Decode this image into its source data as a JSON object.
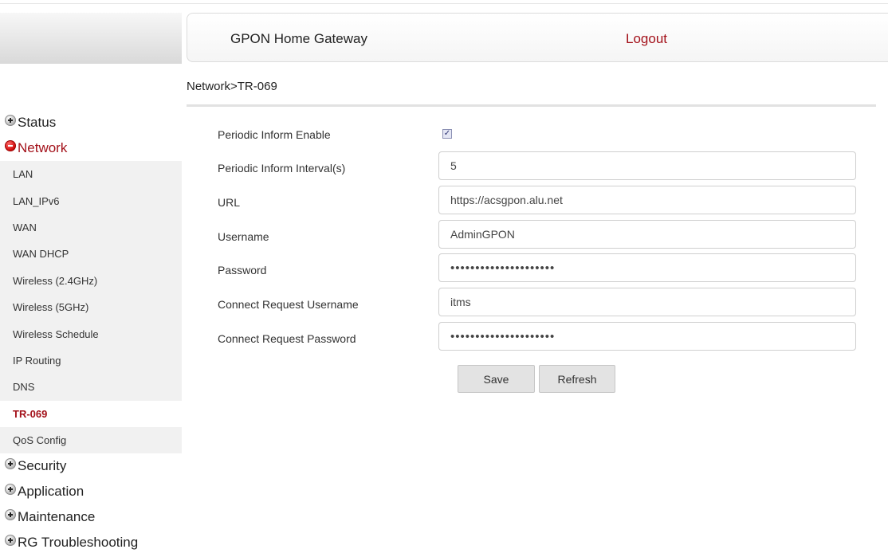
{
  "header": {
    "title": "GPON Home Gateway",
    "logout_label": "Logout"
  },
  "breadcrumb": "Network>TR-069",
  "sidebar": {
    "sections_top": [
      {
        "label": "Status",
        "expanded": false
      },
      {
        "label": "Network",
        "expanded": true
      }
    ],
    "network_items": [
      "LAN",
      "LAN_IPv6",
      "WAN",
      "WAN DHCP",
      "Wireless (2.4GHz)",
      "Wireless (5GHz)",
      "Wireless Schedule",
      "IP Routing",
      "DNS",
      "TR-069",
      "QoS Config"
    ],
    "active_item": "TR-069",
    "sections_bottom": [
      {
        "label": "Security",
        "expanded": false
      },
      {
        "label": "Application",
        "expanded": false
      },
      {
        "label": "Maintenance",
        "expanded": false
      },
      {
        "label": "RG Troubleshooting",
        "expanded": false
      }
    ]
  },
  "form": {
    "periodic_inform_enable": {
      "label": "Periodic Inform Enable",
      "checked": true
    },
    "periodic_inform_interval": {
      "label": "Periodic Inform Interval(s)",
      "value": "5"
    },
    "url": {
      "label": "URL",
      "value": "https://acsgpon.alu.net"
    },
    "username": {
      "label": "Username",
      "value": "AdminGPON"
    },
    "password": {
      "label": "Password",
      "value": "•••••••••••••••••••••"
    },
    "connect_request_username": {
      "label": "Connect Request Username",
      "value": "itms"
    },
    "connect_request_password": {
      "label": "Connect Request Password",
      "value": "•••••••••••••••••••••"
    }
  },
  "buttons": {
    "save_label": "Save",
    "refresh_label": "Refresh"
  },
  "colors": {
    "accent_red": "#a3111a",
    "sidebar_bg": "#f1f1f1"
  },
  "icons": {
    "collapsed": "plus-circle-icon",
    "expanded": "minus-circle-icon"
  }
}
